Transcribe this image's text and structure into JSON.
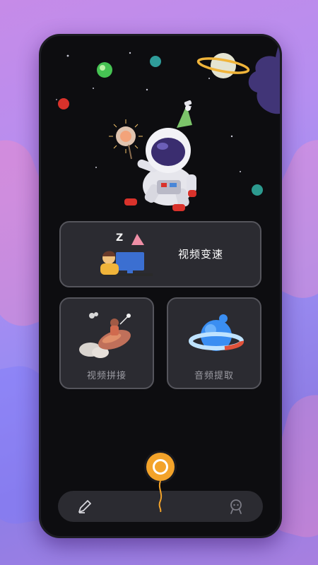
{
  "cards": {
    "speed": {
      "label": "视频变速"
    },
    "splice": {
      "label": "视频拼接"
    },
    "audio": {
      "label": "音频提取"
    }
  },
  "nav": {
    "left_icon": "edit-icon",
    "center_icon": "camera-record-icon",
    "right_icon": "profile-icon"
  },
  "colors": {
    "phone_bg": "#0d0d10",
    "card_bg": "#2b2b31",
    "accent": "#f3a32a"
  }
}
